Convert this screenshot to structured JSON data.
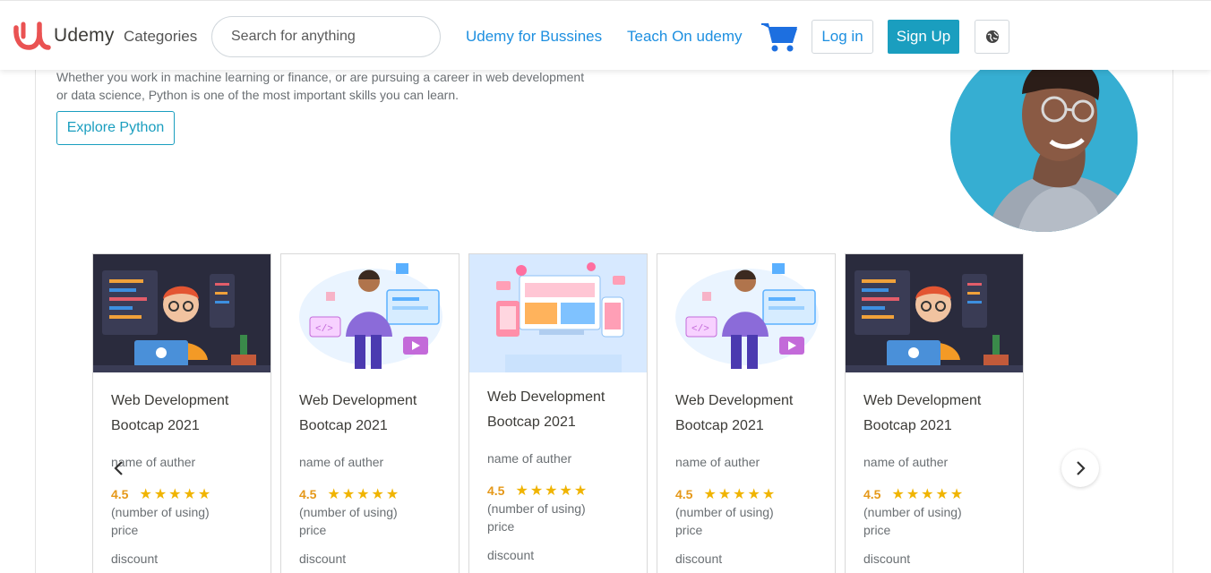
{
  "navbar": {
    "logo_text": "Udemy",
    "categories_label": "Categories",
    "search_placeholder": "Search for anything",
    "business_link": "Udemy for Bussines",
    "teach_link": "Teach On udemy",
    "login_label": "Log in",
    "signup_label": "Sign Up"
  },
  "hero": {
    "description": "Whether you work in machine learning or finance, or are pursuing a career in web development or data science, Python is one of the most important skills you can learn.",
    "explore_label": "Explore Python"
  },
  "courses": [
    {
      "title": "Web Development Bootcap 2021",
      "author": "name of auther",
      "rating": "4.5",
      "stars": "★★★★★",
      "usage": "(number of using)",
      "price": "price",
      "discount": "discount",
      "image": "coding-developer"
    },
    {
      "title": "Web Development Bootcap 2021",
      "author": "name of auther",
      "rating": "4.5",
      "stars": "★★★★★",
      "usage": "(number of using)",
      "price": "price",
      "discount": "discount",
      "image": "developer-dashboard"
    },
    {
      "title": "Web Development Bootcap 2021",
      "author": "name of auther",
      "rating": "4.5",
      "stars": "★★★★★",
      "usage": "(number of using)",
      "price": "price",
      "discount": "discount",
      "image": "responsive-design"
    },
    {
      "title": "Web Development Bootcap 2021",
      "author": "name of auther",
      "rating": "4.5",
      "stars": "★★★★★",
      "usage": "(number of using)",
      "price": "price",
      "discount": "discount",
      "image": "developer-dashboard"
    },
    {
      "title": "Web Development Bootcap 2021",
      "author": "name of auther",
      "rating": "4.5",
      "stars": "★★★★★",
      "usage": "(number of using)",
      "price": "price",
      "discount": "discount",
      "image": "coding-developer"
    }
  ],
  "colors": {
    "brand_red": "#ea5252",
    "link_blue": "#1d8fe0",
    "signup_teal": "#1a9ebf",
    "star_gold": "#f0b400"
  },
  "icons": {
    "cart": "shopping-cart-icon",
    "language": "globe-icon",
    "prev": "chevron-left-icon",
    "next": "chevron-right-icon"
  }
}
